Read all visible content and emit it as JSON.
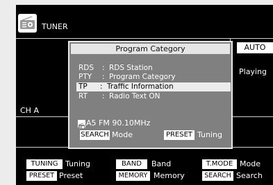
{
  "header": {
    "source_label": "TUNER",
    "source_icon": "radio-icon"
  },
  "status": {
    "mode_badge": "AUTO",
    "playing_label": "Playing",
    "channel_label": "CH A"
  },
  "popup": {
    "title": "Program Category",
    "items": [
      {
        "code": "RDS",
        "colon": ":",
        "desc": "RDS Station",
        "selected": false
      },
      {
        "code": "PTY",
        "colon": ":",
        "desc": "Program Category",
        "selected": false
      },
      {
        "code": "TP",
        "colon": ":",
        "desc": "Traffic Information",
        "selected": true
      },
      {
        "code": "RT",
        "colon": ":",
        "desc": "Radio Text  ON",
        "selected": false
      }
    ],
    "station": "A5 FM 90.10MHz",
    "station_icon": "station-icon",
    "search_key": "SEARCH",
    "search_label": "Mode",
    "preset_key": "PRESET",
    "preset_label": "Tuning"
  },
  "footer": {
    "tuning_key": "TUNING",
    "tuning_label": "Tuning",
    "band_key": "BAND",
    "band_label": "Band",
    "tmode_key": "T.MODE",
    "tmode_label": "Mode",
    "preset_key": "PRESET",
    "preset_label": "Preset",
    "memory_key": "MEMORY",
    "memory_label": "Memory",
    "search_key": "SEARCH",
    "search_label": "Search"
  }
}
